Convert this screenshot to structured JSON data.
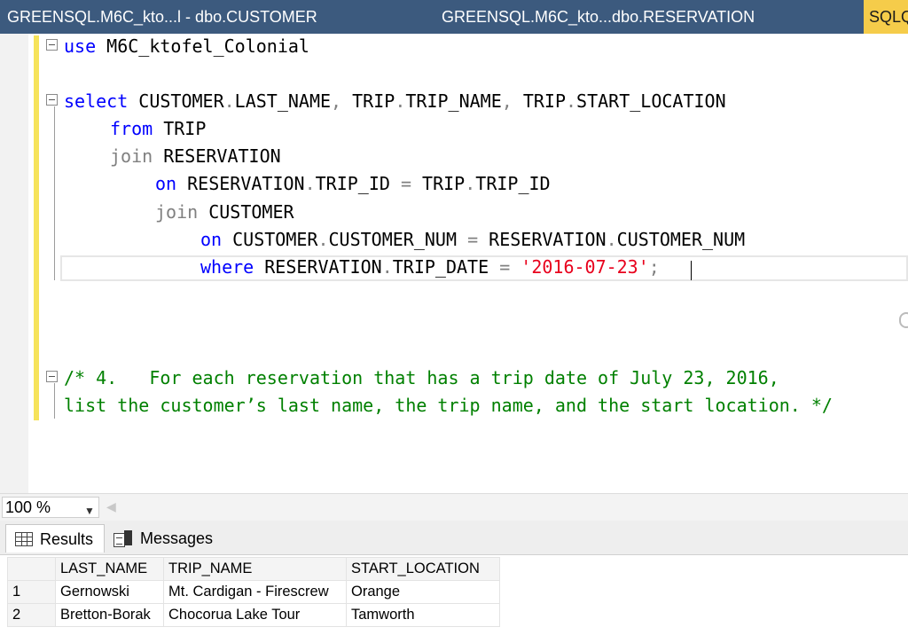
{
  "tabs": [
    {
      "label": "GREENSQL.M6C_kto...l - dbo.CUSTOMER"
    },
    {
      "label": "GREENSQL.M6C_kto...dbo.RESERVATION"
    },
    {
      "label": "SQLQ"
    }
  ],
  "code": {
    "line1": {
      "kw": "use",
      "rest": " M6C_ktofel_Colonial"
    },
    "line2": {
      "kw": "select",
      "a": " CUSTOMER",
      "d1": ".",
      "b": "LAST_NAME",
      "d2": ",",
      "c": " TRIP",
      "d3": ".",
      "d": "TRIP_NAME",
      "d4": ",",
      "e": " TRIP",
      "d5": ".",
      "f": "START_LOCATION"
    },
    "line3": {
      "kw": "from",
      "rest": " TRIP"
    },
    "line4": {
      "kw": "join",
      "rest": " RESERVATION"
    },
    "line5": {
      "kw": "on",
      "a": " RESERVATION",
      "d1": ".",
      "b": "TRIP_ID ",
      "op": "=",
      "c": " TRIP",
      "d2": ".",
      "d": "TRIP_ID"
    },
    "line6": {
      "kw": "join",
      "rest": " CUSTOMER"
    },
    "line7": {
      "kw": "on",
      "a": " CUSTOMER",
      "d1": ".",
      "b": "CUSTOMER_NUM ",
      "op": "=",
      "c": " RESERVATION",
      "d2": ".",
      "d": "CUSTOMER_NUM"
    },
    "line8": {
      "kw": "where",
      "a": " RESERVATION",
      "d1": ".",
      "b": "TRIP_DATE ",
      "op": "=",
      "str": " '2016-07-23'",
      "semi": ";"
    },
    "comment1": "/* 4.   For each reservation that has a trip date of July 23, 2016,",
    "comment2": "list the customer’s last name, the trip name, and the start location. */"
  },
  "zoom": {
    "value": "100 %"
  },
  "result_tabs": [
    {
      "label": "Results"
    },
    {
      "label": "Messages"
    }
  ],
  "results": {
    "columns": [
      "LAST_NAME",
      "TRIP_NAME",
      "START_LOCATION"
    ],
    "rows": [
      {
        "num": "1",
        "last_name": "Gernowski",
        "trip_name": "Mt. Cardigan - Firescrew",
        "start_location": "Orange"
      },
      {
        "num": "2",
        "last_name": "Bretton-Borak",
        "trip_name": "Chocorua Lake Tour",
        "start_location": "Tamworth"
      }
    ]
  },
  "colors": {
    "tab_bar": "#3c5a7e",
    "active_tab": "#f5cc4a",
    "keyword": "#0000ff",
    "string": "#e8001c",
    "comment": "#008000"
  }
}
